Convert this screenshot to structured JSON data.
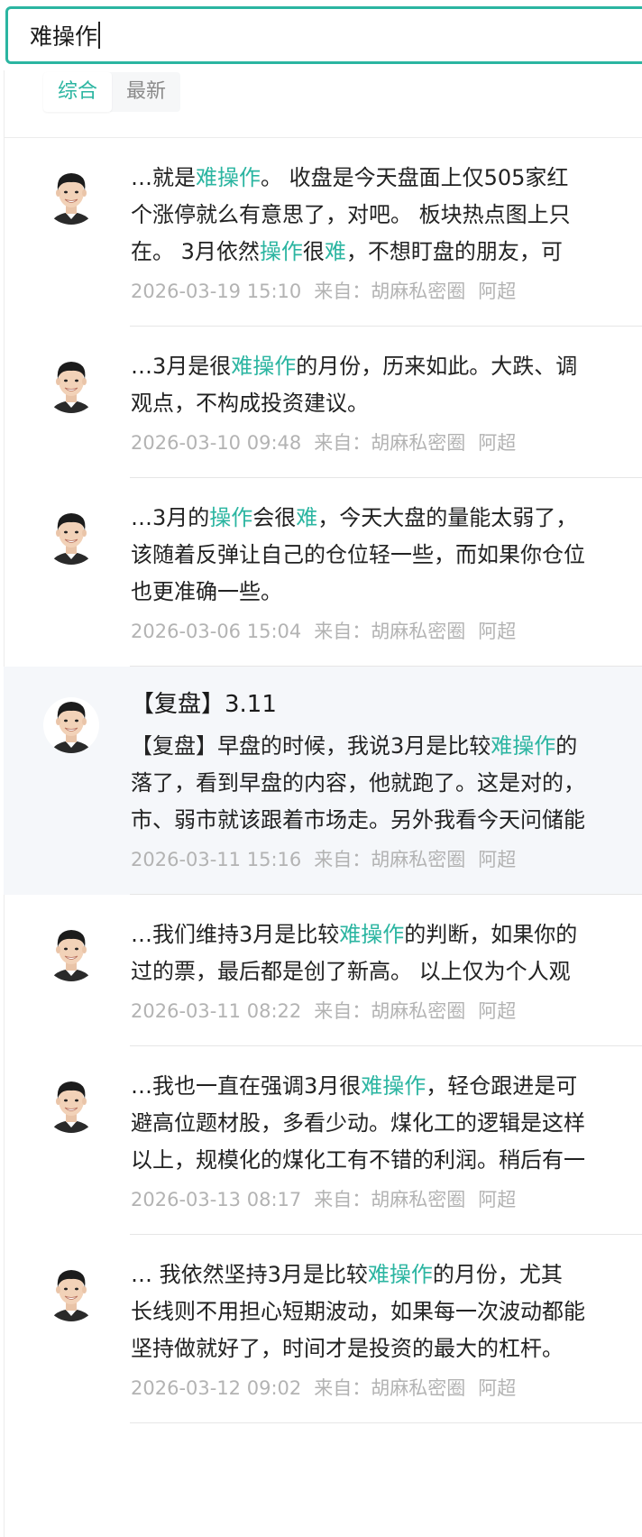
{
  "search": {
    "value": "难操作"
  },
  "tabs": [
    {
      "label": "综合",
      "active": true
    },
    {
      "label": "最新",
      "active": false
    }
  ],
  "colors": {
    "accent": "#2bb5a1",
    "meta": "#b3b3b3",
    "highlight_bg": "#f5f7fa"
  },
  "meta_labels": {
    "from": "来自："
  },
  "posts": [
    {
      "lines": [
        [
          [
            "…就是",
            false
          ],
          [
            "难操作",
            true
          ],
          [
            "。  收盘是今天盘面上仅505家红",
            false
          ]
        ],
        [
          [
            "个涨停就么有意思了，对吧。  板块热点图上只",
            false
          ]
        ],
        [
          [
            "在。  3月依然",
            false
          ],
          [
            "操作",
            true
          ],
          [
            "很",
            false
          ],
          [
            "难",
            true
          ],
          [
            "，不想盯盘的朋友，可",
            false
          ]
        ]
      ],
      "time": "2026-03-19 15:10",
      "source": "胡麻私密圈",
      "author": "阿超"
    },
    {
      "lines": [
        [
          [
            "…3月是很",
            false
          ],
          [
            "难操作",
            true
          ],
          [
            "的月份，历来如此。大跌、调",
            false
          ]
        ],
        [
          [
            "观点，不构成投资建议。",
            false
          ]
        ]
      ],
      "time": "2026-03-10 09:48",
      "source": "胡麻私密圈",
      "author": "阿超"
    },
    {
      "lines": [
        [
          [
            "…3月的",
            false
          ],
          [
            "操作",
            true
          ],
          [
            "会很",
            false
          ],
          [
            "难",
            true
          ],
          [
            "，今天大盘的量能太弱了，",
            false
          ]
        ],
        [
          [
            "该随着反弹让自己的仓位轻一些，而如果你仓位",
            false
          ]
        ],
        [
          [
            "也更准确一些。",
            false
          ]
        ]
      ],
      "time": "2026-03-06 15:04",
      "source": "胡麻私密圈",
      "author": "阿超"
    },
    {
      "title": "【复盘】3.11",
      "highlighted": true,
      "lines": [
        [
          [
            "【复盘】早盘的时候，我说3月是比较",
            false
          ],
          [
            "难操作",
            true
          ],
          [
            "的",
            false
          ]
        ],
        [
          [
            "落了，看到早盘的内容，他就跑了。这是对的，",
            false
          ]
        ],
        [
          [
            "市、弱市就该跟着市场走。另外我看今天问储能",
            false
          ]
        ]
      ],
      "time": "2026-03-11 15:16",
      "source": "胡麻私密圈",
      "author": "阿超"
    },
    {
      "lines": [
        [
          [
            "…我们维持3月是比较",
            false
          ],
          [
            "难操作",
            true
          ],
          [
            "的判断，如果你的",
            false
          ]
        ],
        [
          [
            "过的票，最后都是创了新高。  以上仅为个人观",
            false
          ]
        ]
      ],
      "time": "2026-03-11 08:22",
      "source": "胡麻私密圈",
      "author": "阿超"
    },
    {
      "lines": [
        [
          [
            "…我也一直在强调3月很",
            false
          ],
          [
            "难操作",
            true
          ],
          [
            "，轻仓跟进是可",
            false
          ]
        ],
        [
          [
            "避高位题材股，多看少动。煤化工的逻辑是这样",
            false
          ]
        ],
        [
          [
            "以上，规模化的煤化工有不错的利润。稍后有一",
            false
          ]
        ]
      ],
      "time": "2026-03-13 08:17",
      "source": "胡麻私密圈",
      "author": "阿超"
    },
    {
      "lines": [
        [
          [
            "… 我依然坚持3月是比较",
            false
          ],
          [
            "难操作",
            true
          ],
          [
            "的月份，尤其",
            false
          ]
        ],
        [
          [
            "长线则不用担心短期波动，如果每一次波动都能",
            false
          ]
        ],
        [
          [
            "坚持做就好了，时间才是投资的最大的杠杆。",
            false
          ]
        ]
      ],
      "time": "2026-03-12 09:02",
      "source": "胡麻私密圈",
      "author": "阿超"
    }
  ]
}
